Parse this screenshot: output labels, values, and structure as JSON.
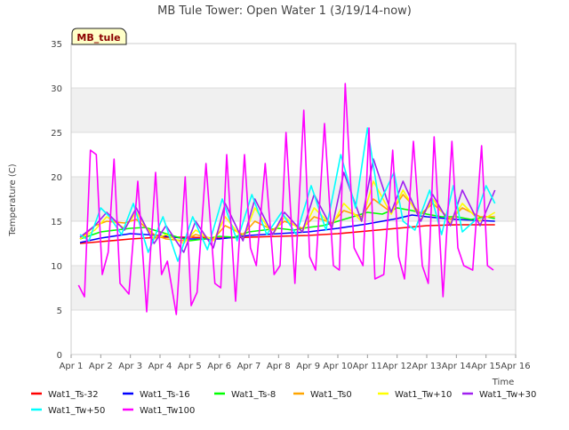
{
  "chart_data": {
    "type": "line",
    "title": "MB Tule Tower: Open Water 1 (3/19/14-now)",
    "xlabel": "Time",
    "ylabel": "Temperature (C)",
    "annotation": "MB_tule",
    "xlim": [
      1,
      16
    ],
    "ylim": [
      0,
      35
    ],
    "x_ticks": [
      {
        "value": 1,
        "label": "Apr 1"
      },
      {
        "value": 2,
        "label": "Apr 2"
      },
      {
        "value": 3,
        "label": "Apr 3"
      },
      {
        "value": 4,
        "label": "Apr 4"
      },
      {
        "value": 5,
        "label": "Apr 5"
      },
      {
        "value": 6,
        "label": "Apr 6"
      },
      {
        "value": 7,
        "label": "Apr 7"
      },
      {
        "value": 8,
        "label": "Apr 8"
      },
      {
        "value": 9,
        "label": "Apr 9"
      },
      {
        "value": 10,
        "label": "Apr 10"
      },
      {
        "value": 11,
        "label": "Apr 11"
      },
      {
        "value": 12,
        "label": "Apr 12"
      },
      {
        "value": 13,
        "label": "Apr 13"
      },
      {
        "value": 14,
        "label": "Apr 14"
      },
      {
        "value": 15,
        "label": "Apr 15"
      },
      {
        "value": 16,
        "label": "Apr 16"
      }
    ],
    "y_ticks": [
      0,
      5,
      10,
      15,
      20,
      25,
      30,
      35
    ],
    "grid": true,
    "legend_position": "bottom",
    "series": [
      {
        "name": "Wat1_Ts-32",
        "color": "#ff0000",
        "x": [
          1.3,
          2,
          3,
          4,
          5,
          6,
          7,
          8,
          9,
          10,
          11,
          12,
          13,
          14,
          15.3
        ],
        "values": [
          12.5,
          12.7,
          13.0,
          13.2,
          13.2,
          13.1,
          13.2,
          13.3,
          13.4,
          13.6,
          13.9,
          14.2,
          14.5,
          14.6,
          14.6
        ]
      },
      {
        "name": "Wat1_Ts-16",
        "color": "#0000ff",
        "x": [
          1.3,
          2,
          3,
          4,
          5,
          6,
          7,
          8,
          9,
          10,
          11,
          12,
          12.5,
          13,
          14,
          15.3
        ],
        "values": [
          12.6,
          13.1,
          13.6,
          13.4,
          13.0,
          13.0,
          13.4,
          13.6,
          13.8,
          14.2,
          14.7,
          15.3,
          15.7,
          15.5,
          15.2,
          15.0
        ]
      },
      {
        "name": "Wat1_Ts-8",
        "color": "#00ff00",
        "x": [
          1.3,
          2,
          2.5,
          3,
          3.5,
          4,
          4.5,
          5,
          5.5,
          6,
          6.5,
          7,
          7.5,
          8,
          8.5,
          9,
          9.5,
          10,
          10.5,
          11,
          11.5,
          12,
          12.5,
          13,
          13.5,
          14,
          14.5,
          15,
          15.3
        ],
        "values": [
          13.0,
          13.8,
          14.0,
          14.2,
          14.3,
          13.8,
          13.3,
          12.8,
          13.0,
          13.3,
          13.2,
          13.8,
          14.0,
          14.2,
          14.0,
          14.3,
          14.5,
          15.0,
          15.5,
          16.0,
          15.8,
          16.5,
          16.2,
          15.8,
          15.5,
          15.5,
          15.2,
          15.5,
          15.3
        ]
      },
      {
        "name": "Wat1_Ts0",
        "color": "#ffa500",
        "x": [
          1.3,
          1.8,
          2.2,
          2.8,
          3.2,
          3.8,
          4.2,
          4.8,
          5.2,
          5.8,
          6.2,
          6.8,
          7.2,
          7.8,
          8.2,
          8.8,
          9.2,
          9.8,
          10.2,
          10.8,
          11.2,
          11.8,
          12.2,
          12.8,
          13.2,
          13.8,
          14.2,
          14.8,
          15.3
        ],
        "values": [
          13.0,
          14.5,
          15.0,
          14.8,
          15.2,
          13.5,
          13.0,
          12.8,
          13.5,
          13.0,
          14.5,
          13.5,
          15.0,
          14.0,
          15.0,
          14.2,
          15.5,
          14.8,
          16.2,
          15.5,
          17.5,
          16.0,
          18.0,
          15.8,
          17.0,
          15.2,
          16.5,
          15.5,
          15.5
        ]
      },
      {
        "name": "Wat1_Tw+10",
        "color": "#ffff00",
        "x": [
          1.3,
          1.8,
          2.2,
          2.8,
          3.2,
          3.8,
          4.2,
          4.8,
          5.2,
          5.8,
          6.2,
          6.8,
          7.2,
          7.8,
          8.2,
          8.8,
          9.2,
          9.8,
          10.2,
          10.8,
          11.2,
          11.8,
          12.2,
          12.8,
          13.2,
          13.8,
          14.2,
          14.8,
          15.3
        ],
        "values": [
          13.0,
          14.0,
          15.5,
          14.2,
          16.0,
          13.0,
          13.5,
          12.5,
          14.0,
          12.8,
          15.5,
          13.0,
          16.5,
          13.5,
          15.5,
          13.8,
          16.5,
          14.5,
          17.0,
          15.0,
          19.5,
          15.8,
          18.5,
          15.2,
          17.5,
          14.8,
          17.0,
          15.0,
          16.0
        ]
      },
      {
        "name": "Wat1_Tw+30",
        "color": "#a020f0",
        "x": [
          1.3,
          1.8,
          2.2,
          2.8,
          3.2,
          3.8,
          4.2,
          4.8,
          5.2,
          5.8,
          6.2,
          6.8,
          7.2,
          7.8,
          8.2,
          8.8,
          9.2,
          9.8,
          10.2,
          10.8,
          11.2,
          11.8,
          12.2,
          12.8,
          13.2,
          13.8,
          14.2,
          14.8,
          15.3
        ],
        "values": [
          13.2,
          14.5,
          16.0,
          14.0,
          16.5,
          12.5,
          14.5,
          11.5,
          15.0,
          12.0,
          17.0,
          12.8,
          17.5,
          13.5,
          16.0,
          13.8,
          18.0,
          14.2,
          20.5,
          15.0,
          22.0,
          16.0,
          19.5,
          15.0,
          18.0,
          14.5,
          18.5,
          14.5,
          18.5
        ]
      },
      {
        "name": "Wat1_Tw+50",
        "color": "#00ffff",
        "x": [
          1.3,
          1.6,
          2.0,
          2.3,
          2.7,
          3.1,
          3.6,
          4.1,
          4.6,
          5.1,
          5.6,
          6.1,
          6.6,
          7.1,
          7.6,
          8.1,
          8.6,
          9.1,
          9.6,
          10.1,
          10.6,
          11.0,
          11.4,
          11.9,
          12.2,
          12.6,
          13.1,
          13.5,
          13.9,
          14.2,
          14.6,
          15.0,
          15.3
        ],
        "values": [
          13.5,
          12.8,
          16.5,
          15.5,
          13.5,
          17.0,
          11.5,
          15.5,
          10.5,
          15.5,
          11.8,
          17.5,
          12.8,
          18.0,
          13.5,
          16.0,
          13.5,
          19.0,
          14.0,
          22.5,
          16.5,
          25.5,
          17.0,
          20.5,
          15.0,
          14.0,
          18.5,
          13.5,
          19.0,
          13.8,
          15.0,
          19.0,
          17.0
        ]
      },
      {
        "name": "Wat1_Tw100",
        "color": "#ff00ff",
        "x": [
          1.25,
          1.45,
          1.65,
          1.85,
          2.05,
          2.25,
          2.45,
          2.65,
          2.95,
          3.25,
          3.55,
          3.85,
          4.05,
          4.25,
          4.55,
          4.85,
          5.05,
          5.25,
          5.55,
          5.85,
          6.05,
          6.25,
          6.55,
          6.85,
          7.05,
          7.25,
          7.55,
          7.85,
          8.05,
          8.25,
          8.55,
          8.85,
          9.05,
          9.25,
          9.55,
          9.85,
          10.05,
          10.25,
          10.55,
          10.85,
          11.05,
          11.25,
          11.55,
          11.85,
          12.05,
          12.25,
          12.55,
          12.85,
          13.05,
          13.25,
          13.55,
          13.85,
          14.05,
          14.25,
          14.55,
          14.85,
          15.05,
          15.25
        ],
        "values": [
          7.8,
          6.5,
          23.0,
          22.5,
          9.0,
          11.5,
          22.0,
          8.0,
          6.8,
          19.5,
          4.8,
          20.5,
          9.0,
          10.5,
          4.5,
          20.0,
          5.5,
          7.0,
          21.5,
          8.0,
          7.5,
          22.5,
          6.0,
          22.5,
          12.0,
          10.0,
          21.5,
          9.0,
          10.0,
          25.0,
          8.0,
          27.5,
          11.0,
          9.5,
          26.0,
          10.0,
          9.5,
          30.5,
          12.0,
          10.0,
          25.5,
          8.5,
          9.0,
          23.0,
          11.0,
          8.5,
          24.0,
          10.0,
          8.0,
          24.5,
          6.5,
          24.0,
          12.0,
          10.0,
          9.5,
          23.5,
          10.0,
          9.5
        ]
      }
    ]
  }
}
